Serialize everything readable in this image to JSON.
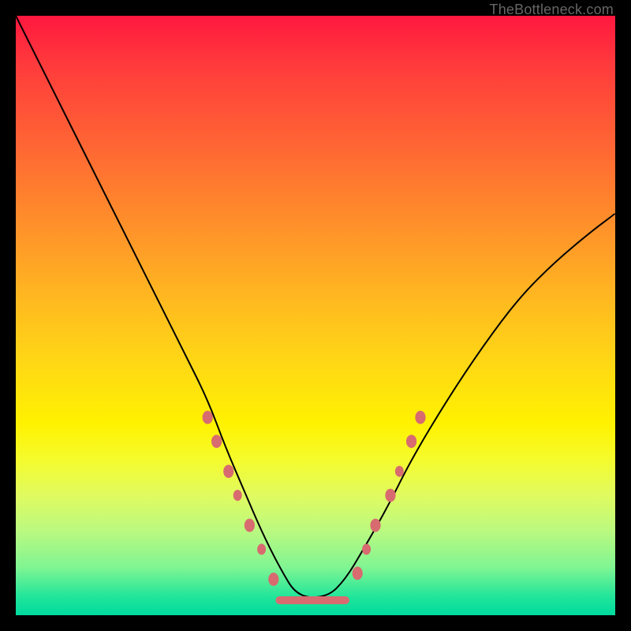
{
  "watermark": "TheBottleneck.com",
  "chart_data": {
    "type": "line",
    "title": "",
    "xlabel": "",
    "ylabel": "",
    "xlim": [
      0,
      100
    ],
    "ylim": [
      0,
      100
    ],
    "grid": false,
    "legend": false,
    "background_gradient": {
      "top": "#ff173f",
      "mid": "#ffd815",
      "bottom": "#00da9e"
    },
    "series": [
      {
        "name": "curve",
        "x": [
          0,
          4,
          8,
          12,
          16,
          20,
          24,
          28,
          32,
          35,
          38,
          41,
          44,
          47,
          52,
          55,
          58,
          62,
          66,
          72,
          78,
          84,
          90,
          96,
          100
        ],
        "y": [
          100,
          92,
          84,
          76,
          68,
          60,
          52,
          44,
          36,
          28,
          21,
          14,
          8,
          3,
          3,
          6,
          11,
          18,
          26,
          36,
          45,
          53,
          59,
          64,
          67
        ]
      }
    ],
    "markers": [
      {
        "x": 32.0,
        "y": 33.0,
        "r": 6
      },
      {
        "x": 33.5,
        "y": 29.0,
        "r": 6
      },
      {
        "x": 35.5,
        "y": 24.0,
        "r": 6
      },
      {
        "x": 37.0,
        "y": 20.0,
        "r": 5
      },
      {
        "x": 39.0,
        "y": 15.0,
        "r": 6
      },
      {
        "x": 41.0,
        "y": 11.0,
        "r": 5
      },
      {
        "x": 43.0,
        "y": 6.0,
        "r": 6
      },
      {
        "x": 57.0,
        "y": 7.0,
        "r": 6
      },
      {
        "x": 58.5,
        "y": 11.0,
        "r": 5
      },
      {
        "x": 60.0,
        "y": 15.0,
        "r": 6
      },
      {
        "x": 62.5,
        "y": 20.0,
        "r": 6
      },
      {
        "x": 64.0,
        "y": 24.0,
        "r": 5
      },
      {
        "x": 66.0,
        "y": 29.0,
        "r": 6
      },
      {
        "x": 67.5,
        "y": 33.0,
        "r": 6
      }
    ],
    "flat_segment": {
      "x0": 44,
      "x1": 55,
      "y": 2.5
    }
  }
}
